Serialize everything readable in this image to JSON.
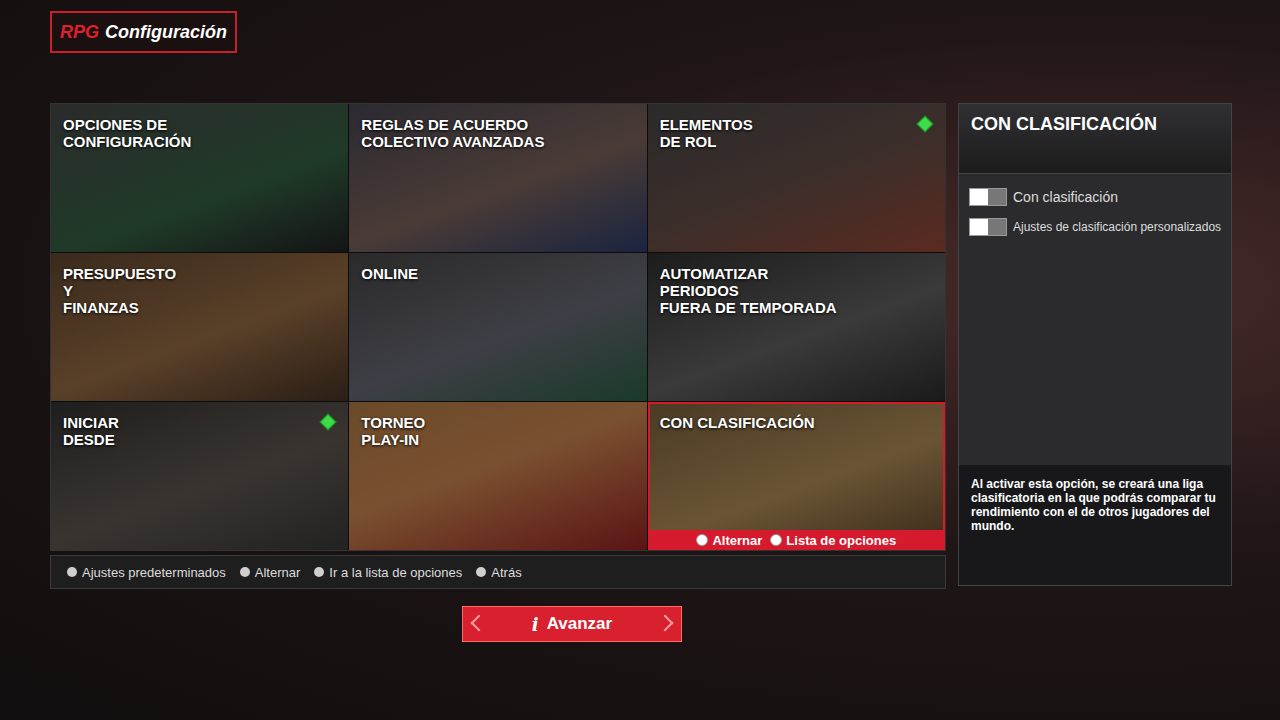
{
  "header": {
    "logo": "RPG",
    "title": "Configuración"
  },
  "tiles": [
    {
      "lines": [
        "OPCIONES DE",
        "CONFIGURACIÓN"
      ],
      "badge": false,
      "selected": false
    },
    {
      "lines": [
        "REGLAS DE ACUERDO",
        "COLECTIVO AVANZADAS"
      ],
      "badge": false,
      "selected": false
    },
    {
      "lines": [
        "ELEMENTOS",
        "DE ROL"
      ],
      "badge": true,
      "selected": false
    },
    {
      "lines": [
        "PRESUPUESTO",
        "Y",
        "FINANZAS"
      ],
      "badge": false,
      "selected": false
    },
    {
      "lines": [
        "ONLINE"
      ],
      "badge": false,
      "selected": false
    },
    {
      "lines": [
        "AUTOMATIZAR",
        "PERIODOS",
        "FUERA DE TEMPORADA"
      ],
      "badge": false,
      "selected": false
    },
    {
      "lines": [
        "INICIAR",
        "DESDE"
      ],
      "badge": true,
      "selected": false
    },
    {
      "lines": [
        "TORNEO",
        "PLAY-IN"
      ],
      "badge": false,
      "selected": false
    },
    {
      "lines": [
        "CON CLASIFICACIÓN"
      ],
      "badge": false,
      "selected": true
    }
  ],
  "selected_tile_actions": [
    "Alternar",
    "Lista de opciones"
  ],
  "hints": [
    "Ajustes predeterminados",
    "Alternar",
    "Ir a la lista de opciones",
    "Atrás"
  ],
  "panel": {
    "title": "CON CLASIFICACIÓN",
    "toggles": [
      {
        "label": "Con clasificación",
        "on": false
      },
      {
        "label": "Ajustes de clasificación personalizados",
        "on": false
      }
    ],
    "description": "Al activar esta opción, se creará una liga clasificatoria en la que podrás comparar tu rendimiento con el de otros jugadores del mundo."
  },
  "advance": {
    "icon": "i",
    "label": "Avanzar"
  }
}
